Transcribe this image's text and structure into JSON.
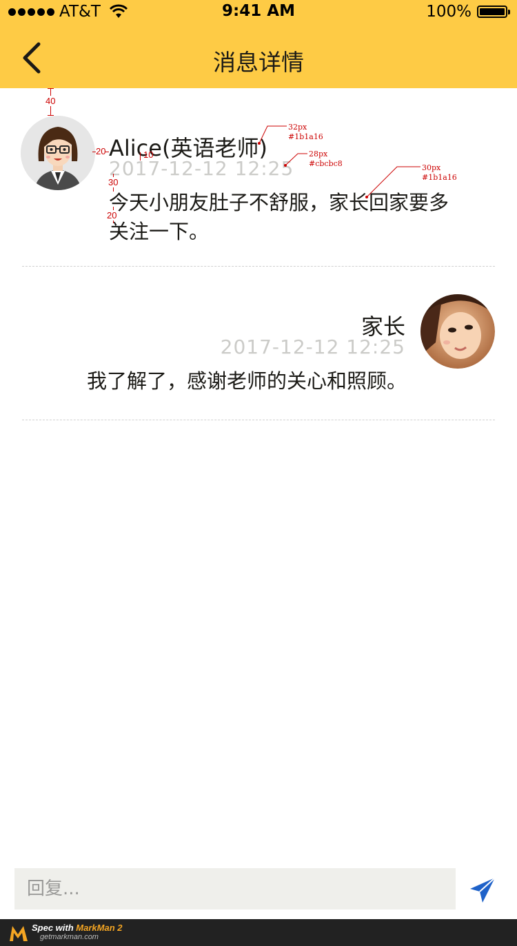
{
  "status_bar": {
    "carrier": "AT&T",
    "time": "9:41 AM",
    "battery": "100%"
  },
  "nav": {
    "title": "消息详情",
    "back_icon": "chevron-left-icon"
  },
  "messages": [
    {
      "name": "Alice(英语老师)",
      "time": "2017-12-12 12:25",
      "text": "今天小朋友肚子不舒服，家长回家要多关注一下。",
      "avatar": "teacher-avatar"
    },
    {
      "name": "家长",
      "time": "2017-12-12 12:25",
      "text": "我了解了，感谢老师的关心和照顾。",
      "avatar": "parent-avatar"
    }
  ],
  "annotations": {
    "name_spec": {
      "size": "32px",
      "color": "#1b1a16"
    },
    "time_spec": {
      "size": "28px",
      "color": "#cbcbc8"
    },
    "text_spec": {
      "size": "30px",
      "color": "#1b1a16"
    },
    "gap_top": "40",
    "gap_avatar_name": "20",
    "gap_name_time": "10",
    "gap_time_text": "30",
    "gap_text_bottom": "20"
  },
  "reply": {
    "placeholder": "回复..."
  },
  "footer": {
    "spec_with": "Spec with ",
    "brand": "MarkMan 2",
    "url": "getmarkman.com"
  },
  "colors": {
    "header_bg": "#fecb45",
    "text_primary": "#1b1a16",
    "text_secondary": "#cbcbc8",
    "send_icon": "#1f62c9"
  }
}
